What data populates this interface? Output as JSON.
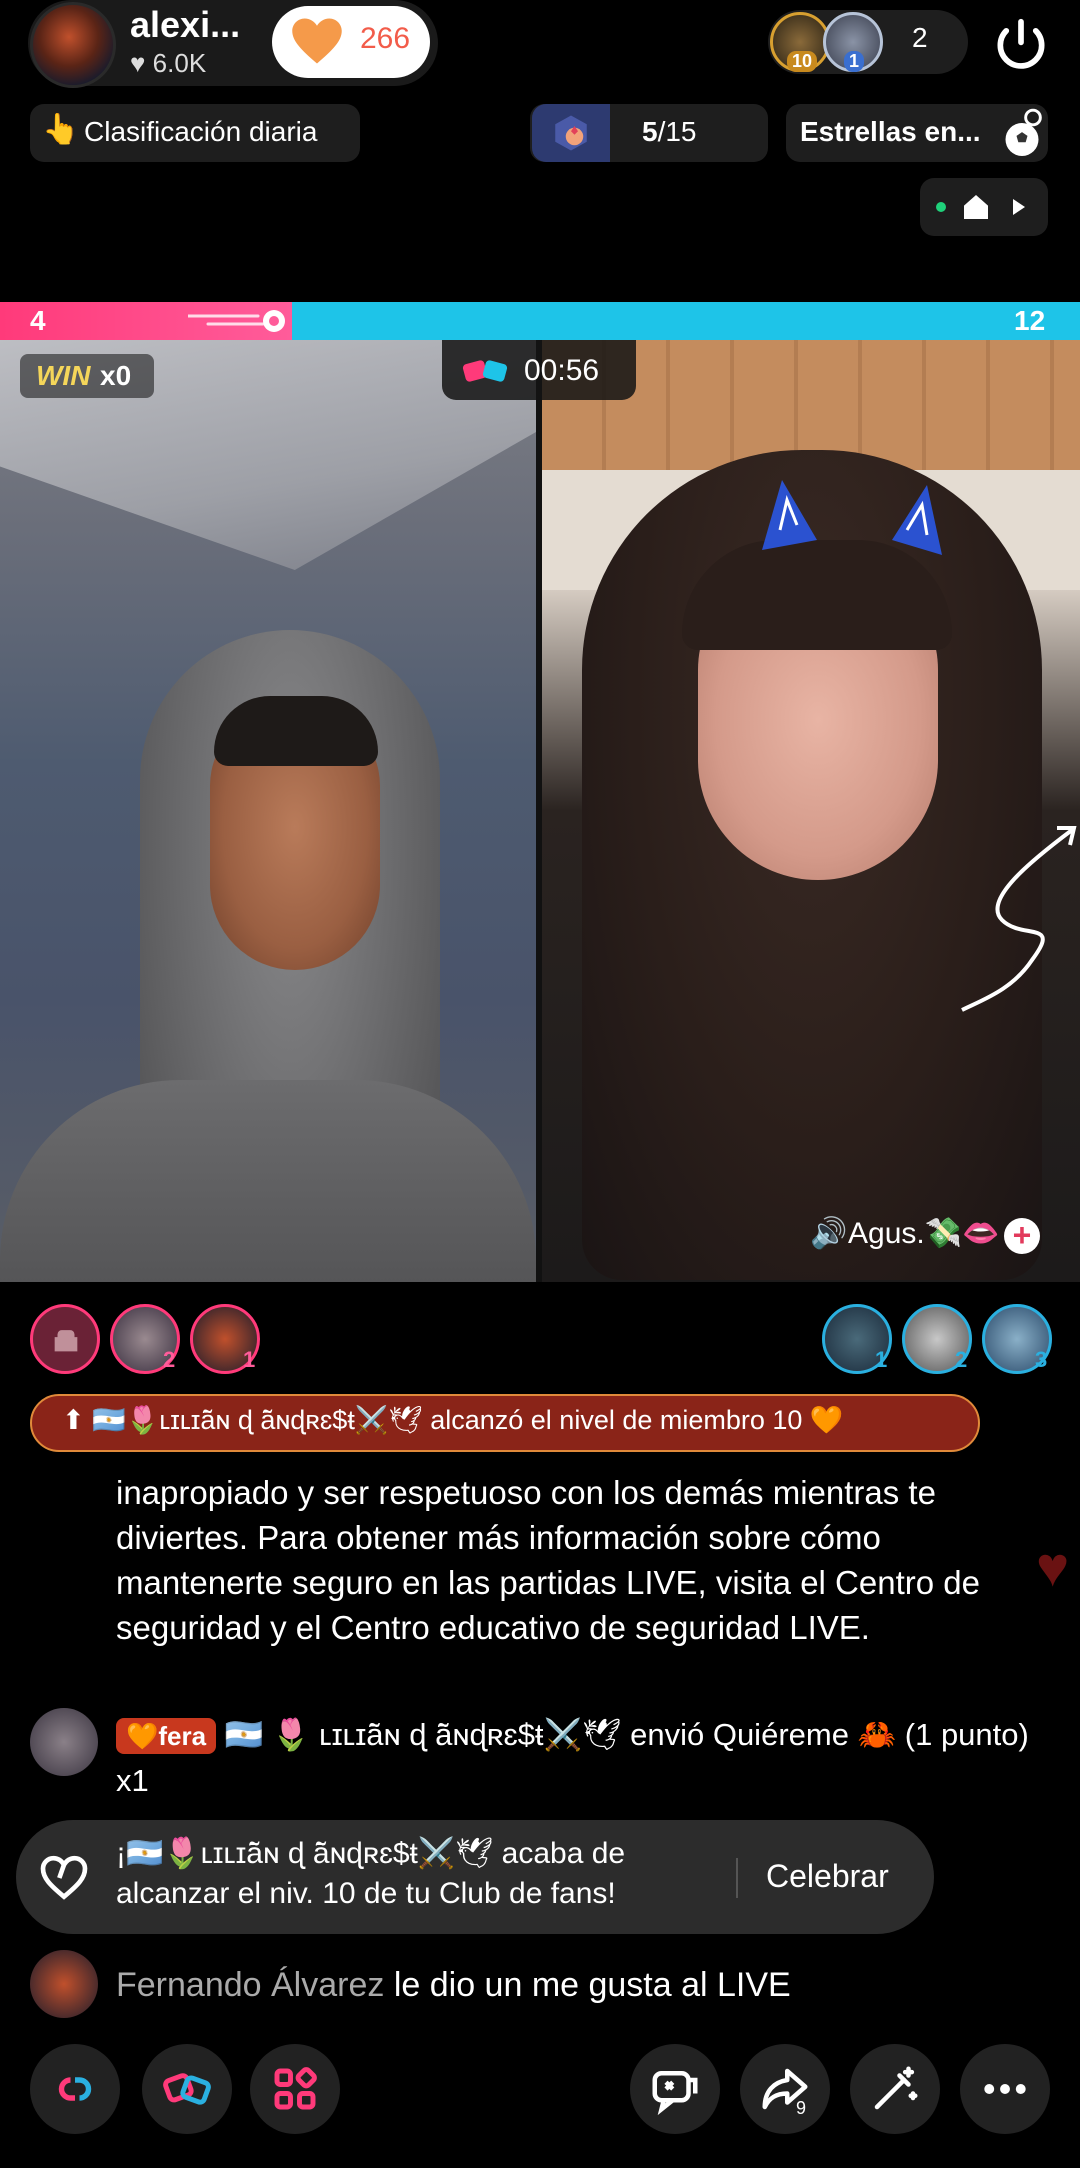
{
  "header": {
    "host_name": "alexi...",
    "host_likes": "6.0K",
    "heart_count": "266",
    "viewer_badges": [
      "10",
      "1"
    ],
    "viewer_count": "2"
  },
  "row2": {
    "ranking_label": "Clasificación diaria",
    "goal_current": "5",
    "goal_total": "/15",
    "stars_label": "Estrellas en..."
  },
  "battle": {
    "left_score": "4",
    "right_score": "12",
    "win_label": "WIN",
    "win_count": "x0",
    "timer": "00:56",
    "guest_name": "Agus.💸👄",
    "left_score_fraction": 0.27
  },
  "supporters": {
    "left_ranks": [
      "2",
      "1"
    ],
    "right_ranks": [
      "1",
      "2",
      "3"
    ]
  },
  "chat": {
    "level_banner": "⬆ 🇦🇷🌷ʟɪʟɪā̃ɴ ɖ ā̃ɴɖʀɛ$ŧ⚔️🕊 alcanzó el nivel de miembro 10 🧡",
    "system_message": "inapropiado y ser respetuoso con los demás mientras te diviertes. Para obtener más información sobre cómo mantenerte seguro en las partidas LIVE, visita el Centro de seguridad y el Centro educativo de seguridad LIVE.",
    "gift_badge": "🧡fera",
    "gift_message": "🇦🇷 🌷 ʟɪʟɪā̃ɴ ɖ ā̃ɴɖʀɛ$ŧ⚔️🕊 envió Quiéreme 🦀 (1 punto) x1",
    "fan_message": "¡🇦🇷🌷ʟɪʟɪā̃ɴ ɖ ā̃ɴɖʀɛ$ŧ⚔️🕊 acaba de alcanzar el niv. 10 de tu Club de fans!",
    "celebrate_label": "Celebrar",
    "like_user": "Fernando Álvarez",
    "like_text": " le dio un me gusta al LIVE"
  },
  "bottom": {
    "share_count": "9"
  },
  "colors": {
    "pk_pink": "#ff3a7a",
    "pk_blue": "#1ec4e8",
    "heart_orange": "#f25c4a"
  }
}
